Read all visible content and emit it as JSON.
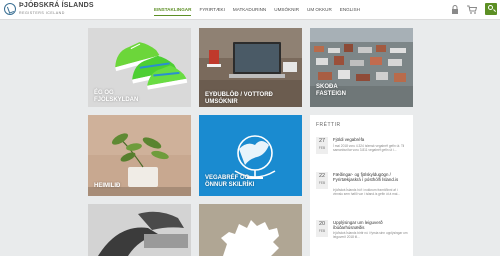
{
  "header": {
    "logo_title": "ÞJÓÐSKRÁ ÍSLANDS",
    "logo_subtitle": "REGISTERS ICELAND",
    "nav": [
      "EINSTAKLINGAR",
      "FYRIRTÆKI",
      "MATKADURINN",
      "UMSÓKNIR",
      "UM OKKUR",
      "ENGLISH"
    ],
    "active_nav": "EINSTAKLINGAR",
    "icons": [
      "lock-icon",
      "cart-icon",
      "search-icon"
    ]
  },
  "tiles": [
    {
      "id": "folk",
      "label_line1": "ÉG OG",
      "label_line2": "FJÖLSKYLDAN"
    },
    {
      "id": "eydublod",
      "label_line1": "EYÐUBLÖÐ / VOTTORÐ",
      "label_line2": "UMSÓKNIR"
    },
    {
      "id": "skoda",
      "label_line1": "SKOÐA",
      "label_line2": "FASTEIGN"
    },
    {
      "id": "heimili",
      "label_line1": "HEIMILIÐ",
      "label_line2": ""
    },
    {
      "id": "vegabref",
      "label_line1": "VEGABRÉF OG",
      "label_line2": "ÖNNUR SKILRÍKI"
    }
  ],
  "news": {
    "title": "FRÉTTIR",
    "items": [
      {
        "day": "27",
        "month": "FEB",
        "headline": "Fjöldi vegabréfa",
        "body": "Í mai 2018 voru 4.324 íslensk vegabréf gefin út. Til samanburðar voru 3.811 vegabréf gefin út í..."
      },
      {
        "day": "22",
        "month": "FEB",
        "headline": "Fæðingar- og fjölskyldugögn / Fyrirtækjaskrá í pósthólfi Ísland.is",
        "body": "Þjóðskrá Íslands hóf í nokkrum framtíðinni af í vinnslu sem hafið var í ísland.is gefin út á mai..."
      },
      {
        "day": "20",
        "month": "FEB",
        "headline": "Upplýsingar um leiguverð íbúðarhúsnæðis",
        "body": "Þjóðskrá Íslands birtir nú í fyrsta sinn upplýsingar um leiguverð 2018 til..."
      }
    ]
  },
  "colors": {
    "accent": "#5c8f24",
    "tile_blue": "#1a8bd0"
  }
}
